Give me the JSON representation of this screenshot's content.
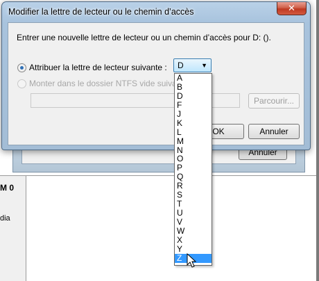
{
  "background": {
    "cancel_label": "Annuler",
    "disk_label": "M 0",
    "disk_sub": "dia"
  },
  "dialog": {
    "title": "Modifier la lettre de lecteur ou le chemin d’accès",
    "close_symbol": "✕",
    "prompt": "Entrer une nouvelle lettre de lecteur ou un chemin d’accès pour D: ().",
    "assign_label": "Attribuer la lettre de lecteur suivante :",
    "mount_label": "Monter dans le dossier NTFS vide suivant :",
    "mount_path_value": "",
    "browse_label": "Parcourir...",
    "ok_label": "OK",
    "cancel_label": "Annuler",
    "assign_checked": true,
    "mount_checked": false
  },
  "drive_combo": {
    "value": "D",
    "arrow": "▼"
  },
  "drive_list": {
    "options": [
      "A",
      "B",
      "D",
      "F",
      "J",
      "K",
      "L",
      "M",
      "N",
      "O",
      "P",
      "Q",
      "R",
      "S",
      "T",
      "U",
      "V",
      "W",
      "X",
      "Y",
      "Z"
    ],
    "highlighted": "Z"
  },
  "colors": {
    "selection": "#3399ff",
    "close_button": "#c8442b",
    "title_bar": "#b9d1e8"
  },
  "icons": {
    "close": "close-icon",
    "dropdown": "chevron-down-icon",
    "cursor": "mouse-pointer-icon"
  }
}
